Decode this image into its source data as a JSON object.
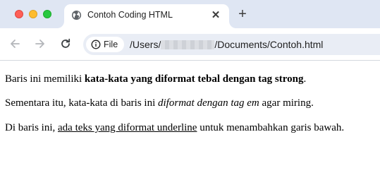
{
  "window": {
    "controls": [
      "close",
      "minimize",
      "zoom"
    ]
  },
  "tab": {
    "title": "Contoh Coding HTML",
    "favicon": "globe-icon",
    "close_glyph": "✕"
  },
  "tabstrip": {
    "new_tab_glyph": "+"
  },
  "toolbar": {
    "back_icon": "arrow-left-icon",
    "forward_icon": "arrow-right-icon",
    "reload_icon": "reload-icon",
    "site_info_label": "File",
    "url_prefix": "/Users/",
    "url_suffix": "/Documents/Contoh.html"
  },
  "page": {
    "para1": {
      "before": "Baris ini memiliki ",
      "strong": "kata-kata yang diformat tebal dengan tag strong",
      "after": "."
    },
    "para2": {
      "before": "Sementara itu, kata-kata di baris ini ",
      "em": "diformat dengan tag em",
      "after": " agar miring."
    },
    "para3": {
      "before": "Di baris ini, ",
      "underline": "ada teks yang diformat underline",
      "after": " untuk menambahkan garis bawah."
    }
  },
  "colors": {
    "tabstrip_bg": "#dfe6f3",
    "omnibox_bg": "#e9edf5",
    "close_red": "#fe5f57",
    "minimize_yellow": "#febc2e",
    "zoom_green": "#28c840"
  }
}
